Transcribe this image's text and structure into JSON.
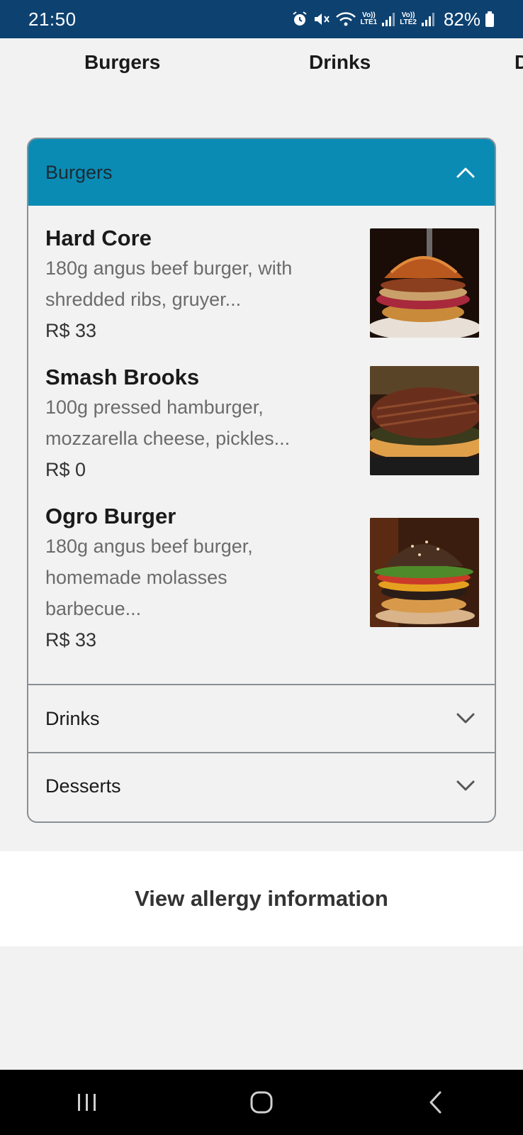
{
  "status_bar": {
    "time": "21:50",
    "net1_top": "Vo))",
    "net1_bottom": "LTE1",
    "net2_top": "Vo))",
    "net2_bottom": "LTE2",
    "battery": "82%",
    "icons": [
      "alarm-icon",
      "mute-icon",
      "wifi-icon",
      "signal-icon",
      "signal-icon",
      "battery-icon"
    ]
  },
  "top_tabs": [
    "Burgers",
    "Drinks",
    "D"
  ],
  "accordion": {
    "open_section": {
      "title": "Burgers",
      "items": [
        {
          "name": "Hard Core",
          "desc_lines": [
            "180g angus beef burger, with",
            "shredded ribs, gruyer..."
          ],
          "price": "R$ 33"
        },
        {
          "name": "Smash Brooks",
          "desc_lines": [
            "100g pressed hamburger,",
            "mozzarella cheese, pickles..."
          ],
          "price": "R$ 0"
        },
        {
          "name": "Ogro Burger",
          "desc_lines": [
            "180g angus beef burger,",
            "homemade molasses",
            "barbecue..."
          ],
          "price": "R$ 33"
        }
      ]
    },
    "closed_sections": [
      "Drinks",
      "Desserts"
    ]
  },
  "allergy_button": "View allergy information",
  "colors": {
    "status_bar": "#0d4170",
    "accordion_header": "#0a8bb4",
    "page_bg": "#f2f2f2"
  }
}
